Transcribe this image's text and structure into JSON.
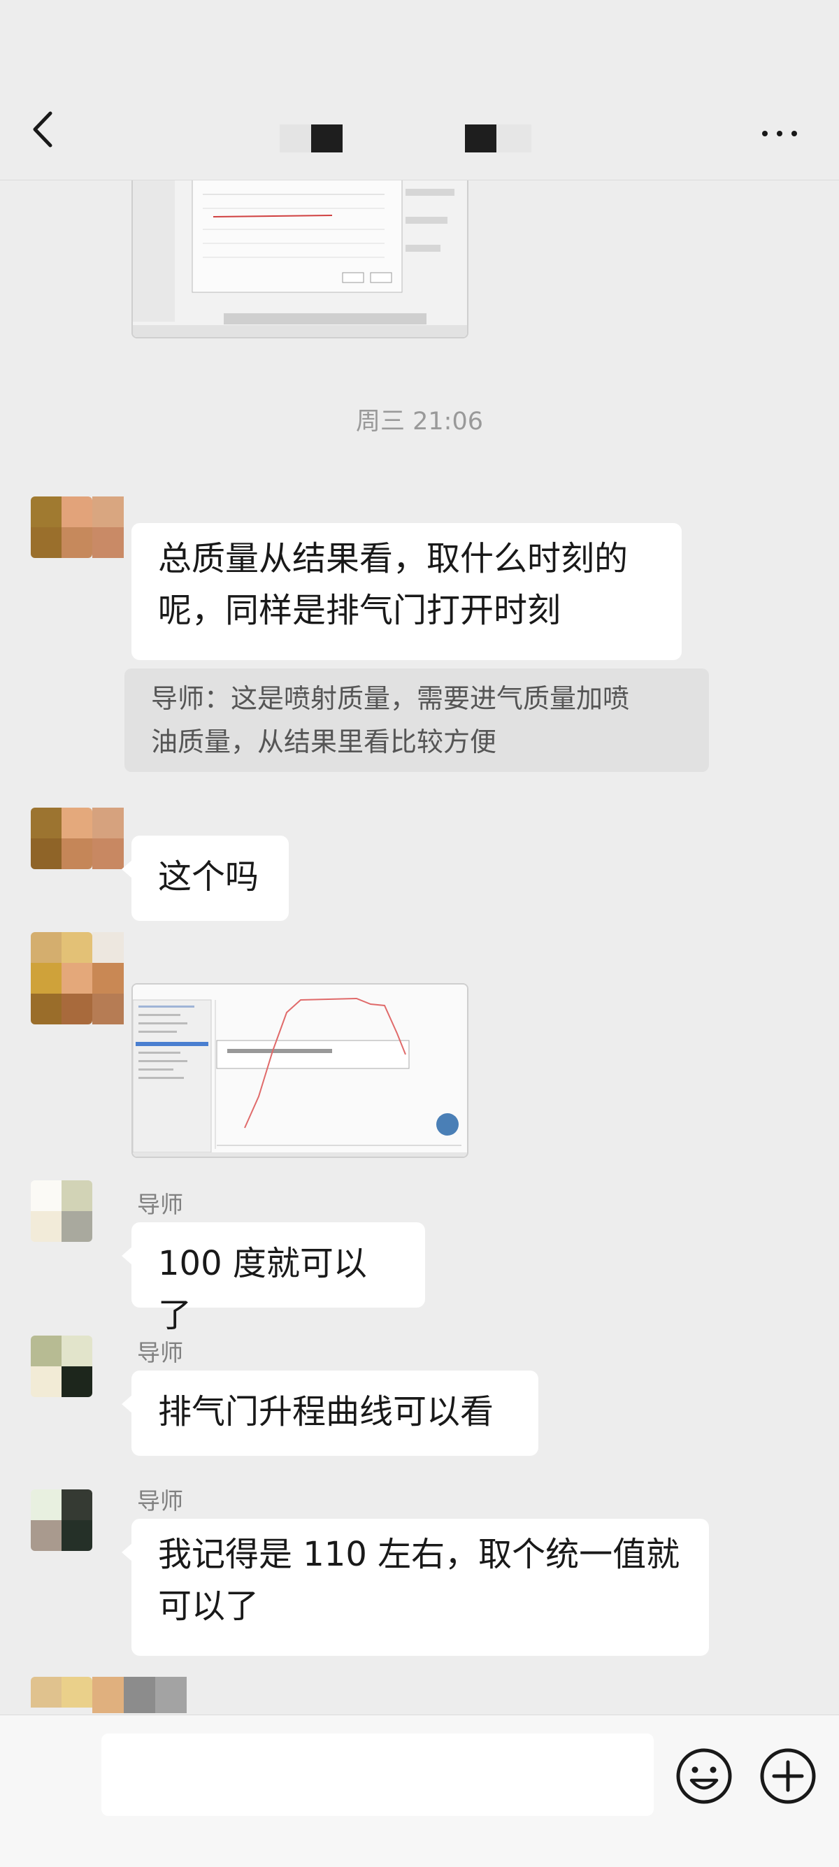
{
  "header": {
    "back_icon": "chevron-left-icon",
    "more_icon": "more-horizontal-icon"
  },
  "chat": {
    "timestamp": "周三 21:06",
    "messages": [
      {
        "text_line1": "总质量从结果看，取什么时刻的",
        "text_line2": "呢，同样是排气门打开时刻",
        "quote_line1": "导师：这是喷射质量，需要进气质量加喷",
        "quote_line2": "油质量，从结果里看比较方便"
      },
      {
        "text": "这个吗"
      },
      {
        "sender": "导师",
        "text": "100 度就可以了"
      },
      {
        "sender": "导师",
        "text": "排气门升程曲线可以看"
      },
      {
        "sender": "导师",
        "text_line1": "我记得是 110 左右，取个统一值就",
        "text_line2": "可以了"
      }
    ]
  },
  "input_bar": {
    "message_value": "",
    "emoji_icon": "emoji-smile-icon",
    "plus_icon": "plus-circle-icon"
  }
}
